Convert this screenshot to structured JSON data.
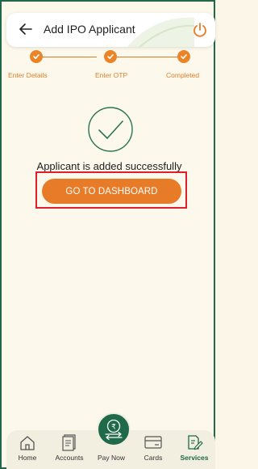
{
  "header": {
    "title": "Add IPO Applicant",
    "back_icon": "arrow-left-icon",
    "power_icon": "power-icon"
  },
  "stepper": {
    "steps": [
      {
        "label": "Enter Details",
        "status": "completed"
      },
      {
        "label": "Enter OTP",
        "status": "completed"
      },
      {
        "label": "Completed",
        "status": "completed"
      }
    ]
  },
  "success": {
    "icon": "check-circle-icon",
    "message": "Applicant is added successfully"
  },
  "cta": {
    "label": "GO TO DASHBOARD"
  },
  "bottom_nav": {
    "items": [
      {
        "label": "Home",
        "icon": "home-icon",
        "active": false
      },
      {
        "label": "Accounts",
        "icon": "document-icon",
        "active": false
      },
      {
        "label": "Pay Now",
        "icon": "rupee-transfer-icon",
        "active": false
      },
      {
        "label": "Cards",
        "icon": "card-icon",
        "active": false
      },
      {
        "label": "Services",
        "icon": "edit-doc-icon",
        "active": true
      }
    ]
  },
  "colors": {
    "accent": "#e77b28",
    "brand_green": "#1f6a49",
    "highlight": "#e01f2d",
    "background": "#fcf8ec"
  }
}
